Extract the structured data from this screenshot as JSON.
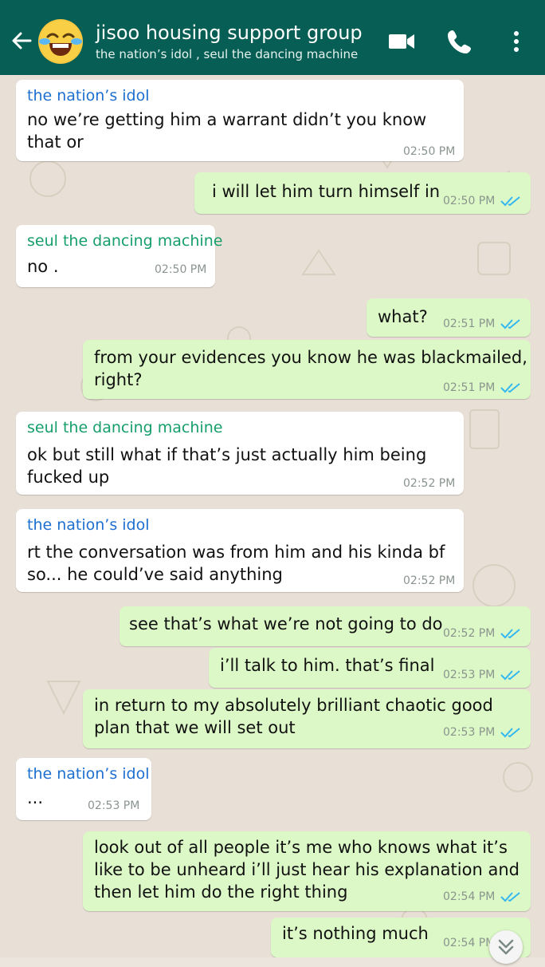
{
  "colors": {
    "header_bg": "#075e54",
    "chat_bg": "#ece5dd",
    "incoming_bubble": "#ffffff",
    "outgoing_bubble": "#dcf8c6",
    "sender_idol": "#1e6fd0",
    "sender_seul": "#169e6b",
    "read_ticks": "#34b7f1"
  },
  "header": {
    "back_icon": "arrow-left-icon",
    "avatar_icon": "laughing-crying-emoji",
    "title": "jisoo housing support group",
    "subtitle": "the nation’s idol , seul the dancing machine",
    "video_icon": "video-camera-icon",
    "call_icon": "phone-icon",
    "menu_icon": "more-vert-icon"
  },
  "messages": [
    {
      "dir": "in",
      "sender": "the nation’s idol",
      "lines": [
        "no we’re getting him a warrant didn’t you know",
        "that or"
      ],
      "time": "02:50 PM"
    },
    {
      "dir": "out",
      "lines": [
        "i will let him turn himself in"
      ],
      "time": "02:50 PM"
    },
    {
      "dir": "in",
      "sender": "seul the dancing machine",
      "lines": [
        "no ."
      ],
      "time": "02:50 PM"
    },
    {
      "dir": "out",
      "lines": [
        "what?"
      ],
      "time": "02:51 PM"
    },
    {
      "dir": "out",
      "lines": [
        "from your evidences you know he was blackmailed,",
        "right?"
      ],
      "time": "02:51 PM"
    },
    {
      "dir": "in",
      "sender": "seul the dancing machine",
      "lines": [
        "ok but still what if that’s just actually him being",
        "fucked up"
      ],
      "time": "02:52 PM"
    },
    {
      "dir": "in",
      "sender": "the nation’s idol",
      "lines": [
        "rt the conversation was from him and his kinda bf",
        "so... he could’ve said anything"
      ],
      "time": "02:52 PM"
    },
    {
      "dir": "out",
      "lines": [
        "see that’s what we’re not going to do"
      ],
      "time": "02:52 PM"
    },
    {
      "dir": "out",
      "lines": [
        "i’ll talk to him. that’s final"
      ],
      "time": "02:53 PM"
    },
    {
      "dir": "out",
      "lines": [
        "in return to my absolutely brilliant chaotic good",
        "plan that we will set out"
      ],
      "time": "02:53 PM"
    },
    {
      "dir": "in",
      "sender": "the nation’s idol",
      "lines": [
        "..."
      ],
      "time": "02:53 PM"
    },
    {
      "dir": "out",
      "lines": [
        "look out of all people it’s me who knows what it’s",
        "like to be unheard i’ll just hear his explanation and",
        "then let him do the right thing"
      ],
      "time": "02:54 PM"
    },
    {
      "dir": "out",
      "lines": [
        "it’s nothing much"
      ],
      "time": "02:54 PM"
    }
  ],
  "scroll_button_icon": "chevrons-down-icon"
}
